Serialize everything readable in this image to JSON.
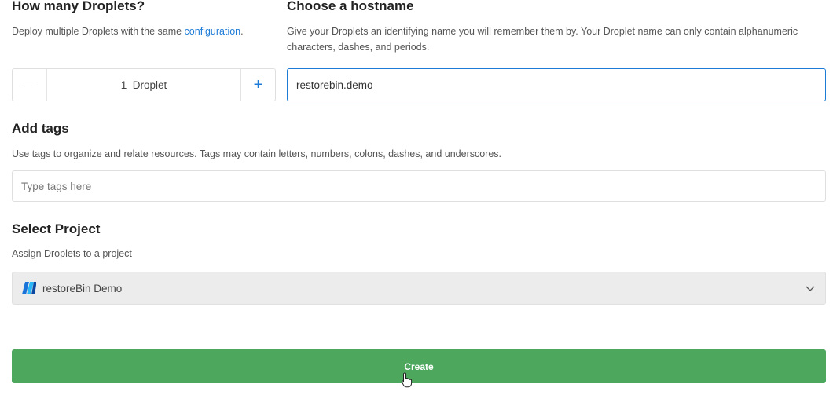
{
  "droplets": {
    "title": "How many Droplets?",
    "desc_prefix": "Deploy multiple Droplets with the same ",
    "desc_link": "configuration",
    "desc_suffix": ".",
    "minus_symbol": "—",
    "count_label": "1  Droplet",
    "plus_symbol": "+"
  },
  "hostname": {
    "title": "Choose a hostname",
    "desc": "Give your Droplets an identifying name you will remember them by. Your Droplet name can only contain alphanumeric characters, dashes, and periods.",
    "value": "restorebin.demo"
  },
  "tags": {
    "title": "Add tags",
    "desc": "Use tags to organize and relate resources. Tags may contain letters, numbers, colons, dashes, and underscores.",
    "placeholder": "Type tags here"
  },
  "project": {
    "title": "Select Project",
    "desc": "Assign Droplets to a project",
    "selected": "restoreBin Demo",
    "icon": "project-stripes-icon"
  },
  "actions": {
    "create_label": "Create",
    "create_color": "#4da85e"
  },
  "colors": {
    "link": "#1d7bd7",
    "accent": "#1d7bd7"
  }
}
